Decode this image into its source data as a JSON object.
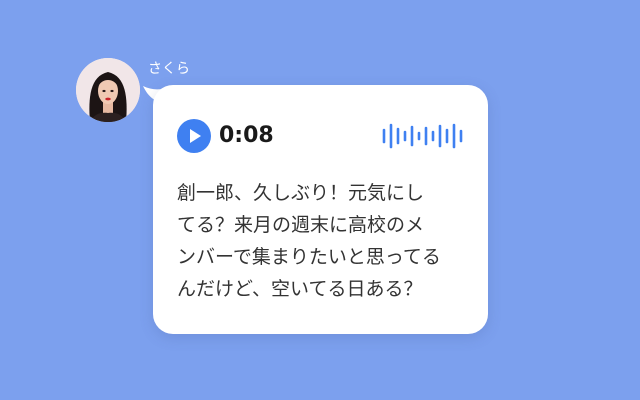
{
  "sender": {
    "name": "さくら"
  },
  "voice_message": {
    "duration": "0:08",
    "play_icon": "play-icon",
    "waveform_icon": "waveform-icon"
  },
  "message": {
    "text": "創一郎、久しぶり！元気にし\nてる？来月の週末に高校のメ\nンバーで集まりたいと思ってる\nんだけど、空いてる日ある？"
  },
  "colors": {
    "background": "#7ca0ee",
    "bubble": "#ffffff",
    "accent": "#3f80f1",
    "text": "#333333"
  }
}
